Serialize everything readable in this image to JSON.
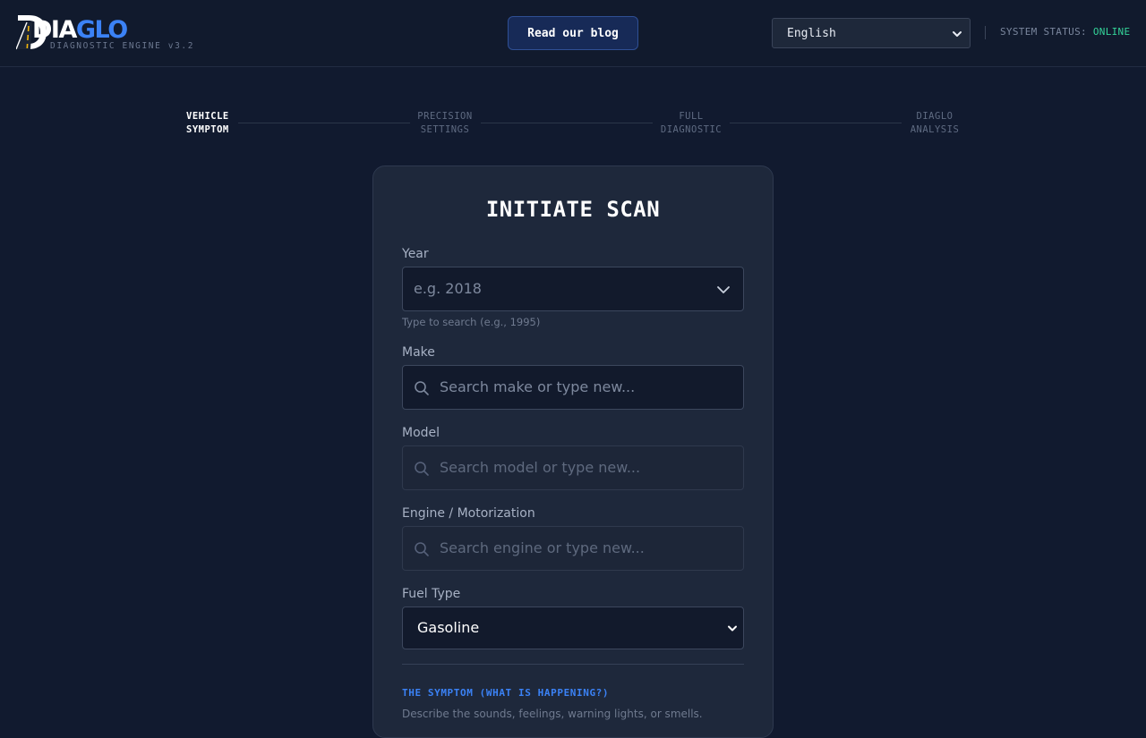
{
  "header": {
    "logo_part1": "DIA",
    "logo_part2": "GLO",
    "logo_subtitle": "DIAGNOSTIC ENGINE v3.2",
    "blog_button": "Read our blog",
    "language": "English",
    "status_label": "SYSTEM STATUS:",
    "status_value": "ONLINE"
  },
  "stepper": {
    "steps": [
      {
        "line1": "VEHICLE",
        "line2": "SYMPTOM",
        "active": true
      },
      {
        "line1": "PRECISION",
        "line2": "SETTINGS",
        "active": false
      },
      {
        "line1": "FULL",
        "line2": "DIAGNOSTIC",
        "active": false
      },
      {
        "line1": "DIAGLO",
        "line2": "ANALYSIS",
        "active": false
      }
    ]
  },
  "form": {
    "title": "INITIATE SCAN",
    "year": {
      "label": "Year",
      "placeholder": "e.g. 2018",
      "hint": "Type to search (e.g., 1995)"
    },
    "make": {
      "label": "Make",
      "placeholder": "Search make or type new..."
    },
    "model": {
      "label": "Model",
      "placeholder": "Search model or type new..."
    },
    "engine": {
      "label": "Engine / Motorization",
      "placeholder": "Search engine or type new..."
    },
    "fuel": {
      "label": "Fuel Type",
      "value": "Gasoline"
    },
    "symptom_title": "THE SYMPTOM (WHAT IS HAPPENING?)",
    "symptom_desc": "Describe the sounds, feelings, warning lights, or smells."
  },
  "colors": {
    "accent": "#3b82f6",
    "online": "#34d399",
    "background": "#111a2f",
    "card": "#1e283b"
  }
}
